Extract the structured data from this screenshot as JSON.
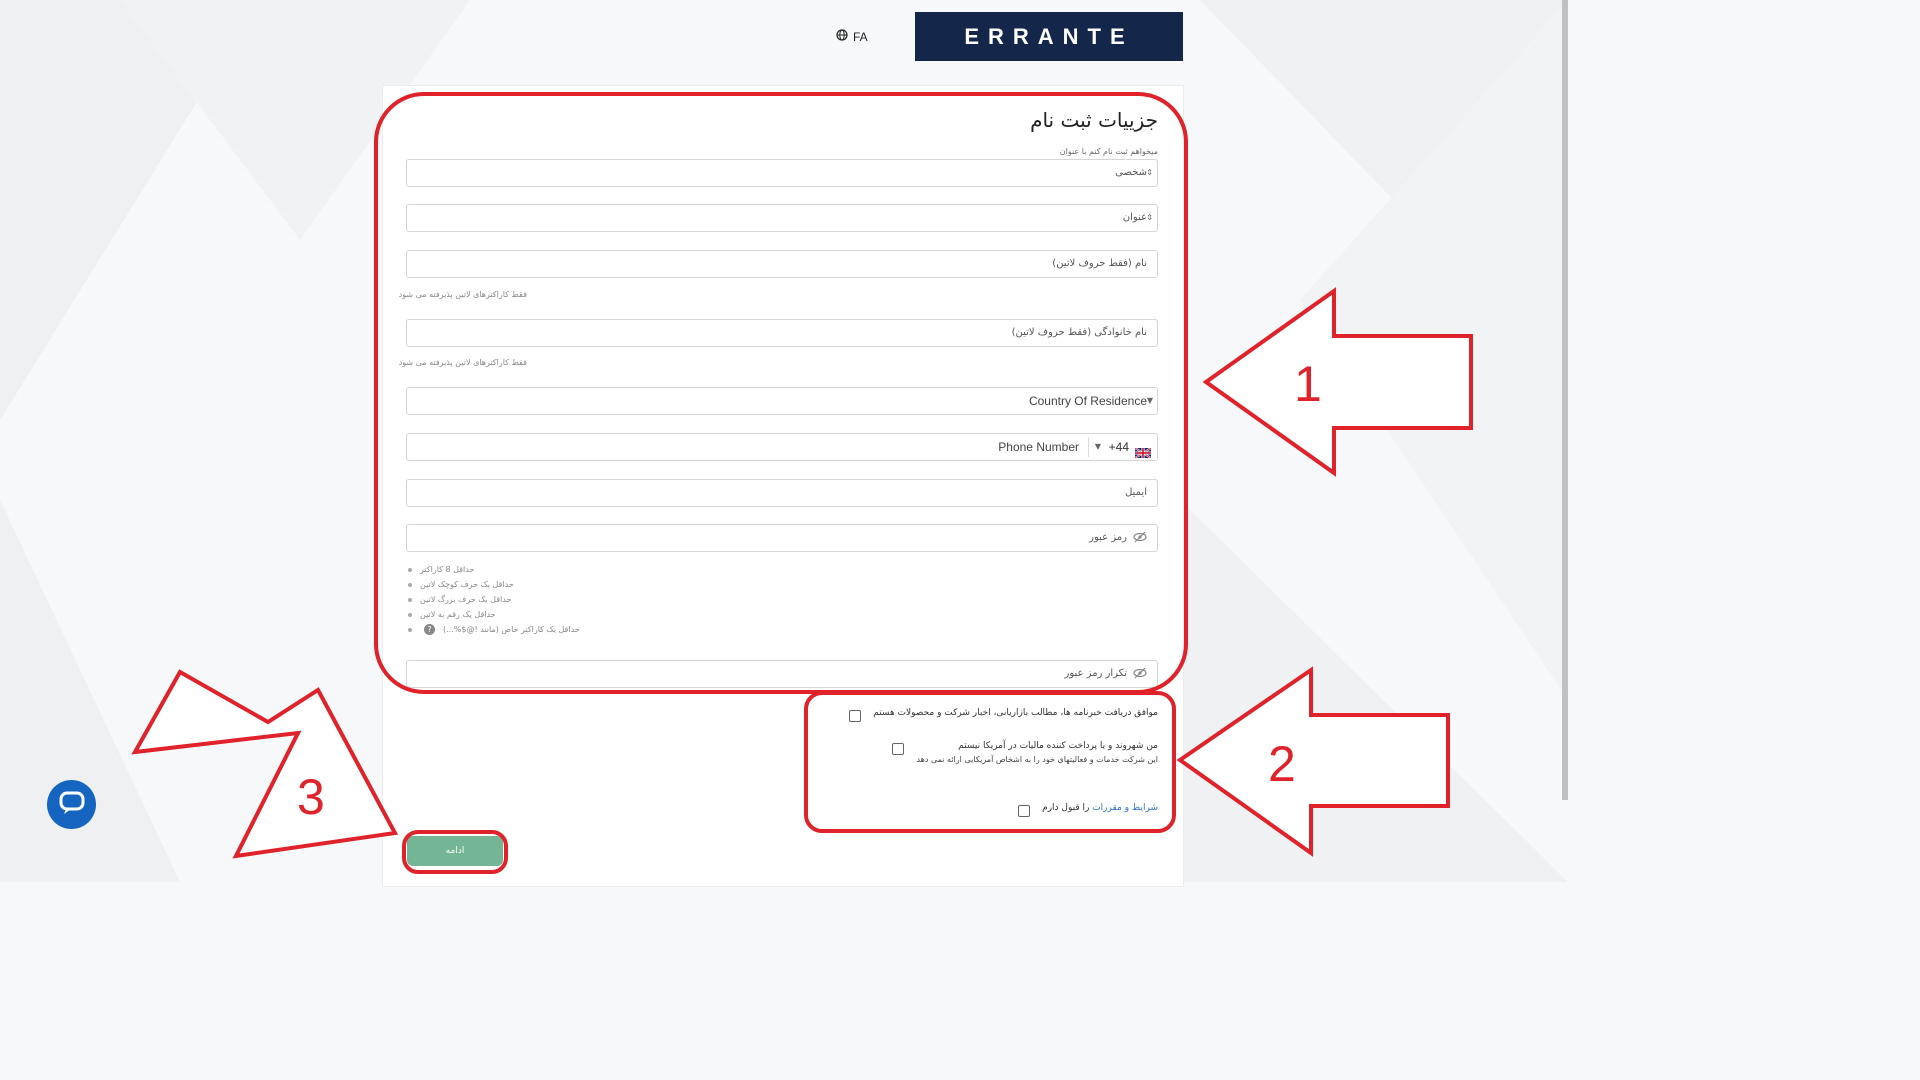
{
  "header": {
    "language": "FA",
    "logo_text": "ERRANTE"
  },
  "form": {
    "title": "جزییات ثبت نام",
    "register_as_label": "میخواهم ثبت نام کنم با عنوان",
    "account_type": "شخصی",
    "salutation": "عنوان",
    "first_name_placeholder": "نام (فقط حروف لاتین)",
    "first_name_hint": "فقط کاراکترهای لاتین پذیرفته می شود",
    "last_name_placeholder": "نام خانوادگی (فقط حروف لاتین)",
    "last_name_hint": "فقط کاراکترهای لاتین پذیرفته می شود",
    "country_placeholder": "Country Of Residence",
    "phone_code": "+44",
    "phone_placeholder": "Phone Number",
    "email_placeholder": "ایمیل",
    "password_placeholder": "رمز عبور",
    "password_rules": [
      "حداقل 8 کاراکتر",
      "حداقل یک حرف کوچک لاتین",
      "حداقل یک حرف بزرگ لاتین",
      "حداقل یک رقم به لاتین",
      "حداقل یک کاراکتر خاص (مانند !@$%...)"
    ],
    "confirm_password_placeholder": "تکرار رمز عبور"
  },
  "consents": {
    "newsletter": "موافق دریافت خبرنامه ها، مطالب بازاریابی، اخبار شرکت و محصولات هستم",
    "us_citizen": "من شهروند و یا پرداخت کننده مالیات در آمریکا نیستم",
    "us_citizen_note": "این شرکت خدمات و فعالیتهای خود را به اشخاص آمریکایی ارائه نمی دهد",
    "terms_link": "شرایط و مقررات",
    "terms_suffix": "را قبول دارم"
  },
  "actions": {
    "continue_label": "ادامه"
  },
  "annotations": {
    "label_1": "1",
    "label_2": "2",
    "label_3": "3",
    "color": "#e0222a"
  }
}
